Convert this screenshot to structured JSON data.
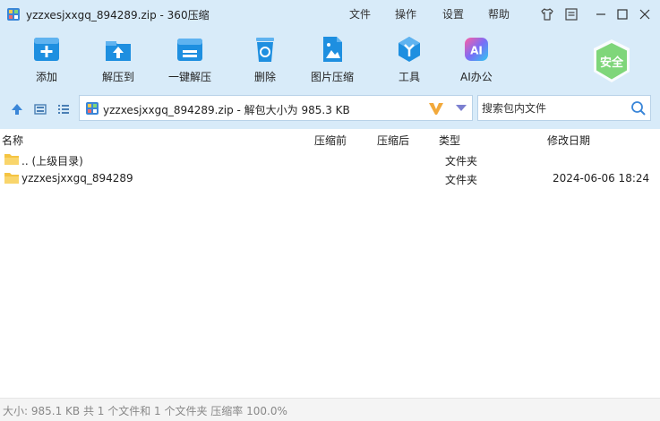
{
  "window": {
    "title": "yzzxesjxxgq_894289.zip - 360压缩",
    "menus": [
      "文件",
      "操作",
      "设置",
      "帮助"
    ]
  },
  "toolbar": {
    "items": [
      {
        "label": "添加",
        "icon": "add-file-icon"
      },
      {
        "label": "解压到",
        "icon": "extract-to-icon"
      },
      {
        "label": "一键解压",
        "icon": "one-click-extract-icon"
      },
      {
        "label": "删除",
        "icon": "delete-icon"
      },
      {
        "label": "图片压缩",
        "icon": "image-compress-icon"
      },
      {
        "label": "工具",
        "icon": "tools-icon"
      },
      {
        "label": "AI办公",
        "icon": "ai-office-icon"
      }
    ],
    "safe_label": "安全",
    "ai_badge": "AI"
  },
  "address": {
    "text": "yzzxesjxxgq_894289.zip - 解包大小为 985.3 KB"
  },
  "search": {
    "placeholder": "搜索包内文件"
  },
  "columns": {
    "name": "名称",
    "before": "压缩前",
    "after": "压缩后",
    "type": "类型",
    "modified": "修改日期"
  },
  "files": [
    {
      "name": ".. (上级目录)",
      "type": "文件夹",
      "modified": ""
    },
    {
      "name": "yzzxesjxxgq_894289",
      "type": "文件夹",
      "modified": "2024-06-06 18:24"
    }
  ],
  "status": {
    "text": "大小: 985.1 KB 共 1 个文件和 1 个文件夹 压缩率 100.0%"
  },
  "colors": {
    "chrome": "#d8ebf9",
    "accent": "#1e8fe0",
    "folder": "#f5c442",
    "safe_green": "#7fd67a"
  }
}
